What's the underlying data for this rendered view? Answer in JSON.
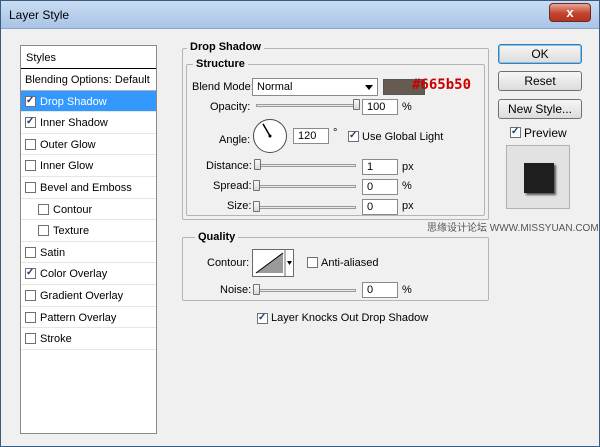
{
  "window": {
    "title": "Layer Style",
    "close_label": "x"
  },
  "styles_panel": {
    "header": "Styles",
    "items": [
      {
        "label": "Blending Options: Default",
        "checkbox": false,
        "checked": false,
        "selected": false,
        "indent": false
      },
      {
        "label": "Drop Shadow",
        "checkbox": true,
        "checked": true,
        "selected": true,
        "indent": false
      },
      {
        "label": "Inner Shadow",
        "checkbox": true,
        "checked": true,
        "selected": false,
        "indent": false
      },
      {
        "label": "Outer Glow",
        "checkbox": true,
        "checked": false,
        "selected": false,
        "indent": false
      },
      {
        "label": "Inner Glow",
        "checkbox": true,
        "checked": false,
        "selected": false,
        "indent": false
      },
      {
        "label": "Bevel and Emboss",
        "checkbox": true,
        "checked": false,
        "selected": false,
        "indent": false
      },
      {
        "label": "Contour",
        "checkbox": true,
        "checked": false,
        "selected": false,
        "indent": true
      },
      {
        "label": "Texture",
        "checkbox": true,
        "checked": false,
        "selected": false,
        "indent": true
      },
      {
        "label": "Satin",
        "checkbox": true,
        "checked": false,
        "selected": false,
        "indent": false
      },
      {
        "label": "Color Overlay",
        "checkbox": true,
        "checked": true,
        "selected": false,
        "indent": false
      },
      {
        "label": "Gradient Overlay",
        "checkbox": true,
        "checked": false,
        "selected": false,
        "indent": false
      },
      {
        "label": "Pattern Overlay",
        "checkbox": true,
        "checked": false,
        "selected": false,
        "indent": false
      },
      {
        "label": "Stroke",
        "checkbox": true,
        "checked": false,
        "selected": false,
        "indent": false
      }
    ]
  },
  "drop_shadow": {
    "group_title": "Drop Shadow",
    "structure_title": "Structure",
    "blend_mode_label": "Blend Mode:",
    "blend_mode_value": "Normal",
    "color_hex": "#665b50",
    "color_label": "#665b50",
    "color_label_color": "#cc0000",
    "opacity_label": "Opacity:",
    "opacity_value": "100",
    "opacity_pct": 100,
    "opacity_unit": "%",
    "angle_label": "Angle:",
    "angle_value": "120",
    "angle_degrees": 120,
    "angle_unit": "°",
    "use_global_light_label": "Use Global Light",
    "use_global_light": true,
    "distance_label": "Distance:",
    "distance_value": "1",
    "distance_pct": 1,
    "distance_unit": "px",
    "spread_label": "Spread:",
    "spread_value": "0",
    "spread_pct": 0,
    "spread_unit": "%",
    "size_label": "Size:",
    "size_value": "0",
    "size_pct": 0,
    "size_unit": "px"
  },
  "quality": {
    "group_title": "Quality",
    "contour_label": "Contour:",
    "anti_aliased_label": "Anti-aliased",
    "anti_aliased": false,
    "noise_label": "Noise:",
    "noise_value": "0",
    "noise_pct": 0,
    "noise_unit": "%"
  },
  "knockout": {
    "label": "Layer Knocks Out Drop Shadow",
    "checked": true
  },
  "buttons": {
    "ok": "OK",
    "reset": "Reset",
    "new_style": "New Style..."
  },
  "preview": {
    "label": "Preview",
    "checked": true
  },
  "watermark": "思缘设计论坛 WWW.MISSYUAN.COM"
}
